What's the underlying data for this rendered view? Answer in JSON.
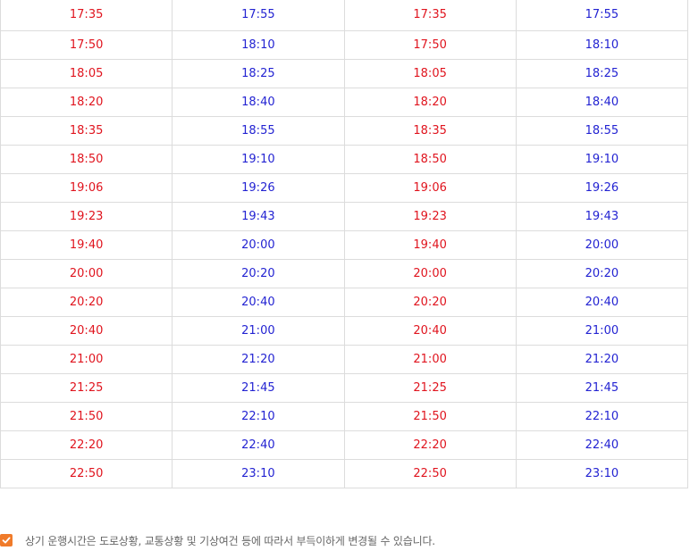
{
  "colors": {
    "depart": "#e0141e",
    "arrive": "#2323d2",
    "accent": "#f07b2a"
  },
  "schedule": {
    "rows": [
      [
        "17:35",
        "17:55",
        "17:35",
        "17:55"
      ],
      [
        "17:50",
        "18:10",
        "17:50",
        "18:10"
      ],
      [
        "18:05",
        "18:25",
        "18:05",
        "18:25"
      ],
      [
        "18:20",
        "18:40",
        "18:20",
        "18:40"
      ],
      [
        "18:35",
        "18:55",
        "18:35",
        "18:55"
      ],
      [
        "18:50",
        "19:10",
        "18:50",
        "19:10"
      ],
      [
        "19:06",
        "19:26",
        "19:06",
        "19:26"
      ],
      [
        "19:23",
        "19:43",
        "19:23",
        "19:43"
      ],
      [
        "19:40",
        "20:00",
        "19:40",
        "20:00"
      ],
      [
        "20:00",
        "20:20",
        "20:00",
        "20:20"
      ],
      [
        "20:20",
        "20:40",
        "20:20",
        "20:40"
      ],
      [
        "20:40",
        "21:00",
        "20:40",
        "21:00"
      ],
      [
        "21:00",
        "21:20",
        "21:00",
        "21:20"
      ],
      [
        "21:25",
        "21:45",
        "21:25",
        "21:45"
      ],
      [
        "21:50",
        "22:10",
        "21:50",
        "22:10"
      ],
      [
        "22:20",
        "22:40",
        "22:20",
        "22:40"
      ],
      [
        "22:50",
        "23:10",
        "22:50",
        "23:10"
      ]
    ]
  },
  "notice": {
    "icon": "check-icon",
    "text": "상기 운행시간은 도로상황, 교통상황 및 기상여건 등에 따라서 부득이하게 변경될 수 있습니다."
  }
}
